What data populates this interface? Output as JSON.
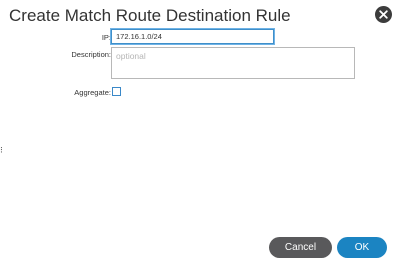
{
  "dialog": {
    "title": "Create Match Route Destination Rule",
    "close_icon": "close-icon"
  },
  "form": {
    "ip_label": "IP:",
    "ip_value": "172.16.1.0/24",
    "description_label": "Description:",
    "description_placeholder": "optional",
    "description_value": "",
    "aggregate_label": "Aggregate:",
    "aggregate_checked": false
  },
  "buttons": {
    "cancel_label": "Cancel",
    "ok_label": "OK"
  },
  "colors": {
    "ok_button": "#1b84c2",
    "cancel_button": "#59595b",
    "focus_border": "#3f8fca",
    "close_button": "#3c3c3c"
  }
}
